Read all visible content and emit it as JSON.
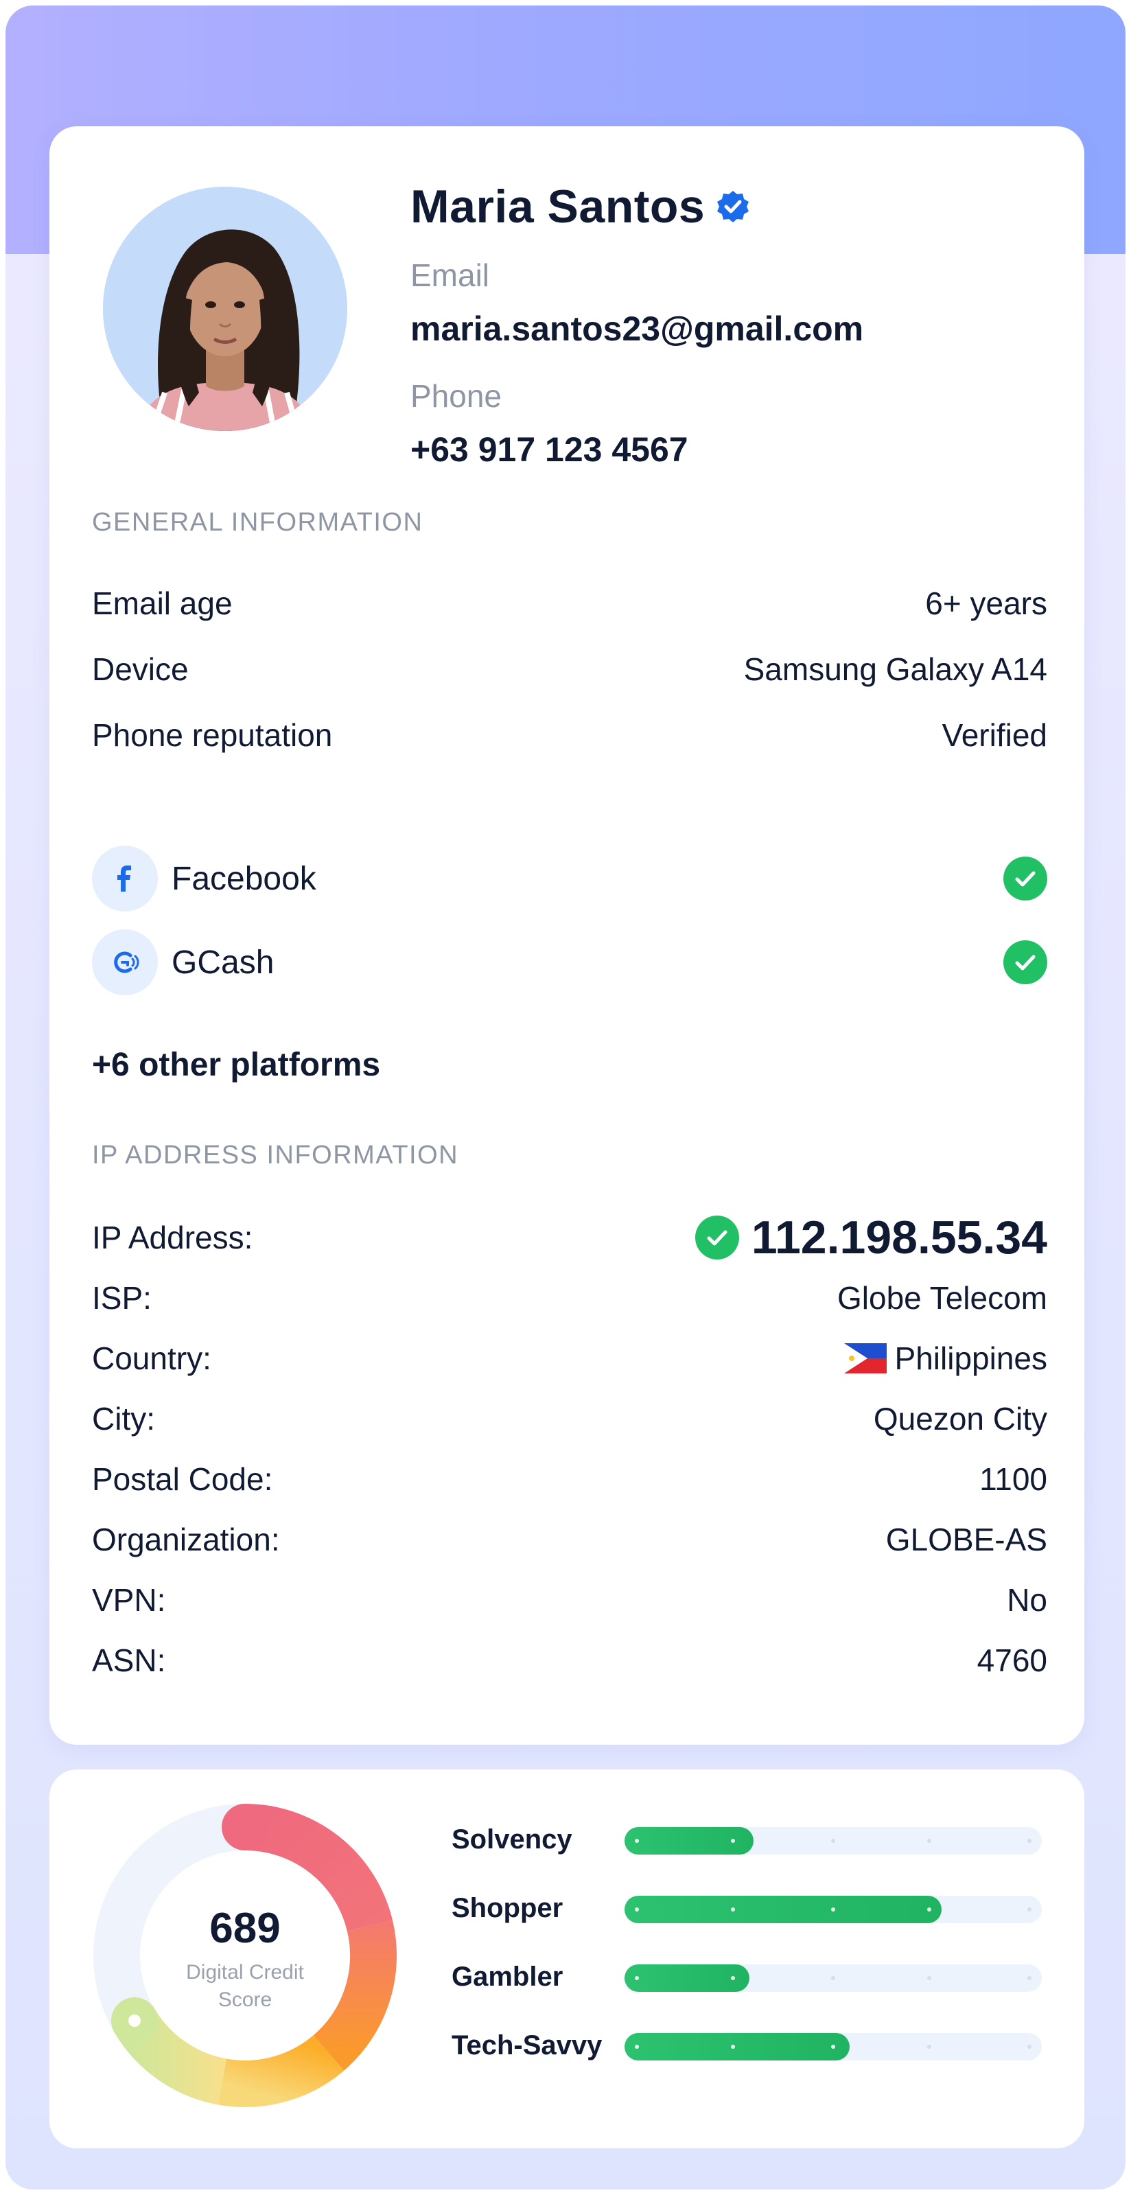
{
  "profile": {
    "name": "Maria Santos",
    "email_label": "Email",
    "email": "maria.santos23@gmail.com",
    "phone_label": "Phone",
    "phone": "+63 917 123 4567"
  },
  "general": {
    "title": "GENERAL INFORMATION",
    "rows": [
      {
        "label": "Email age",
        "value": "6+ years"
      },
      {
        "label": "Device",
        "value": "Samsung Galaxy A14"
      },
      {
        "label": "Phone reputation",
        "value": "Verified"
      }
    ]
  },
  "platforms": {
    "items": [
      {
        "name": "Facebook",
        "icon": "facebook-icon",
        "status": "verified"
      },
      {
        "name": "GCash",
        "icon": "gcash-icon",
        "status": "verified"
      }
    ],
    "more": "+6 other platforms"
  },
  "ip": {
    "title": "IP ADDRESS INFORMATION",
    "address_label": "IP Address:",
    "address": "112.198.55.34",
    "rows": [
      {
        "label": "ISP:",
        "value": "Globe Telecom"
      },
      {
        "label": "Country:",
        "value": "Philippines"
      },
      {
        "label": "City:",
        "value": "Quezon City"
      },
      {
        "label": "Postal Code:",
        "value": "1100"
      },
      {
        "label": "Organization:",
        "value": "GLOBE-AS"
      },
      {
        "label": "VPN:",
        "value": "No"
      },
      {
        "label": "ASN:",
        "value": "4760"
      }
    ]
  },
  "score": {
    "value": "689",
    "label": "Digital Credit Score",
    "traits": [
      {
        "label": "Solvency",
        "level": 0.31
      },
      {
        "label": "Shopper",
        "level": 0.76
      },
      {
        "label": "Gambler",
        "level": 0.3
      },
      {
        "label": "Tech-Savvy",
        "level": 0.54
      }
    ]
  },
  "colors": {
    "accent": "#1c6bea",
    "success": "#22c064",
    "bar_fill": "#22b865",
    "heading": "#111a33",
    "muted": "#8f96a3"
  }
}
